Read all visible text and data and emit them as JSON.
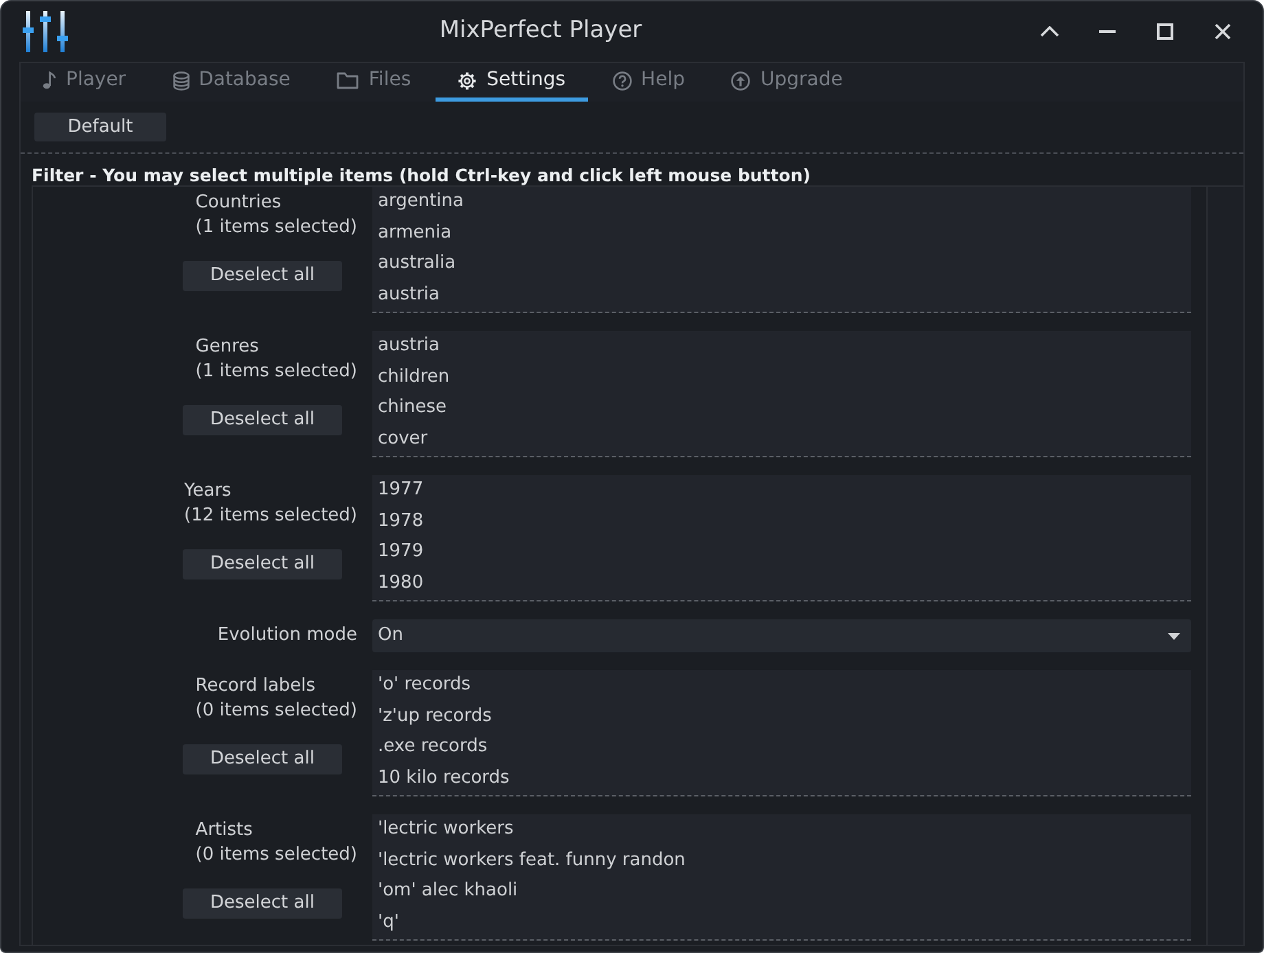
{
  "window": {
    "title": "MixPerfect Player"
  },
  "tabs": [
    {
      "label": "Player",
      "selected": false
    },
    {
      "label": "Database",
      "selected": false
    },
    {
      "label": "Files",
      "selected": false
    },
    {
      "label": "Settings",
      "selected": true
    },
    {
      "label": "Help",
      "selected": false
    },
    {
      "label": "Upgrade",
      "selected": false
    }
  ],
  "toolbar": {
    "default_button": "Default"
  },
  "filter": {
    "heading": "Filter - You may select multiple items (hold Ctrl-key and click left mouse button)",
    "fields": [
      {
        "kind": "list",
        "label": "Countries",
        "count": "(1 items selected)",
        "button": "Deselect all",
        "items": [
          {
            "text": "argentina",
            "selected": false
          },
          {
            "text": "armenia",
            "selected": false
          },
          {
            "text": "australia",
            "selected": false
          },
          {
            "text": "austria",
            "selected": false
          }
        ]
      },
      {
        "kind": "list",
        "label": "Genres",
        "count": "(1 items selected)",
        "button": "Deselect all",
        "items": [
          {
            "text": "austria",
            "selected": false
          },
          {
            "text": "children",
            "selected": false
          },
          {
            "text": "chinese",
            "selected": false
          },
          {
            "text": "cover",
            "selected": false
          }
        ]
      },
      {
        "kind": "list",
        "label": "Years",
        "count": "(12 items selected)",
        "button": "Deselect all",
        "items": [
          {
            "text": "1977",
            "selected": false
          },
          {
            "text": "1978",
            "selected": false
          },
          {
            "text": "1979",
            "selected": false
          },
          {
            "text": "1980",
            "selected": false
          }
        ]
      },
      {
        "kind": "select",
        "label": "Evolution mode",
        "value": "On"
      },
      {
        "kind": "list",
        "label": "Record labels",
        "count": "(0 items selected)",
        "button": "Deselect all",
        "items": [
          {
            "text": "'o' records",
            "selected": false
          },
          {
            "text": "'z'up records",
            "selected": false
          },
          {
            "text": ".exe records",
            "selected": false
          },
          {
            "text": "10 kilo records",
            "selected": false
          }
        ]
      },
      {
        "kind": "list",
        "label": "Artists",
        "count": "(0 items selected)",
        "button": "Deselect all",
        "items": [
          {
            "text": "'lectric workers",
            "selected": false
          },
          {
            "text": "'lectric workers feat. funny randon",
            "selected": false
          },
          {
            "text": "'om' alec khaoli",
            "selected": false
          },
          {
            "text": "'q'",
            "selected": false
          }
        ]
      }
    ]
  }
}
